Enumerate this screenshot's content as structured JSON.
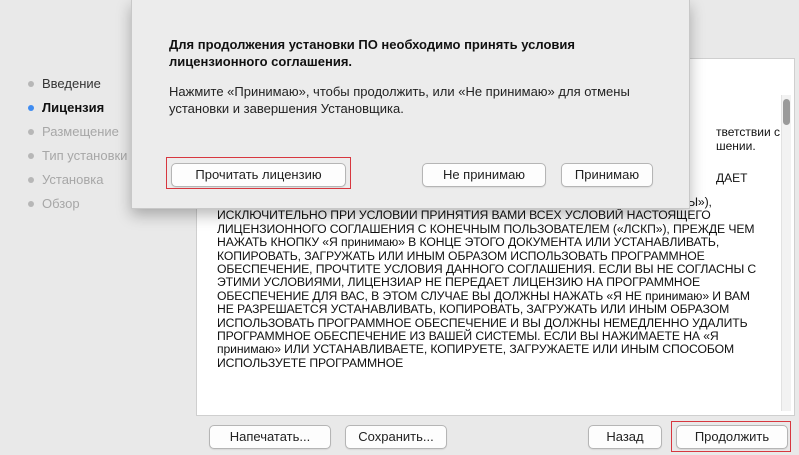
{
  "sidebar": {
    "steps": [
      {
        "label": "Введение",
        "state": "done"
      },
      {
        "label": "Лицензия",
        "state": "active"
      },
      {
        "label": "Размещение",
        "state": "future"
      },
      {
        "label": "Тип установки",
        "state": "future"
      },
      {
        "label": "Установка",
        "state": "future"
      },
      {
        "label": "Обзор",
        "state": "future"
      }
    ]
  },
  "sheet": {
    "title": "Для продолжения установки ПО необходимо принять условия лицензионного соглашения.",
    "body": "Нажмите «Принимаю», чтобы продолжить, или «Не принимаю» для отмены установки и завершения Установщика.",
    "read_license": "Прочитать лицензию",
    "disagree": "Не принимаю",
    "agree": "Принимаю"
  },
  "license": {
    "frag_line1": "тветствии с",
    "frag_line2": "шении.",
    "frag_line3": "ДАЕТ",
    "text": "ЮРИДИЧЕСКОМУ ЛИЦУ, ПРИНИМАЮЩЕМУ ПРОГРАММНОЕ ОБЕСПЕЧЕНИЕ («ВЫ»), ИСКЛЮЧИТЕЛЬНО ПРИ УСЛОВИИ ПРИНЯТИЯ ВАМИ ВСЕХ УСЛОВИЙ НАСТОЯЩЕГО ЛИЦЕНЗИОННОГО СОГЛАШЕНИЯ С КОНЕЧНЫМ ПОЛЬЗОВАТЕЛЕМ («ЛСКП»), ПРЕЖДЕ ЧЕМ НАЖАТЬ КНОПКУ «Я принимаю» В КОНЦЕ ЭТОГО ДОКУМЕНТА ИЛИ УСТАНАВЛИВАТЬ, КОПИРОВАТЬ, ЗАГРУЖАТЬ ИЛИ ИНЫМ ОБРАЗОМ ИСПОЛЬЗОВАТЬ ПРОГРАММНОЕ ОБЕСПЕЧЕНИЕ, ПРОЧТИТЕ УСЛОВИЯ ДАННОГО СОГЛАШЕНИЯ. ЕСЛИ ВЫ НЕ СОГЛАСНЫ С ЭТИМИ УСЛОВИЯМИ, ЛИЦЕНЗИАР НЕ ПЕРЕДАЕТ ЛИЦЕНЗИЮ НА ПРОГРАММНОЕ ОБЕСПЕЧЕНИЕ ДЛЯ ВАС, В ЭТОМ СЛУЧАЕ ВЫ ДОЛЖНЫ НАЖАТЬ «Я НЕ принимаю» И ВАМ НЕ РАЗРЕШАЕТСЯ УСТАНАВЛИВАТЬ, КОПИРОВАТЬ, ЗАГРУЖАТЬ ИЛИ ИНЫМ ОБРАЗОМ ИСПОЛЬЗОВАТЬ ПРОГРАММНОЕ ОБЕСПЕЧЕНИЕ И ВЫ ДОЛЖНЫ НЕМЕДЛЕННО УДАЛИТЬ ПРОГРАММНОЕ ОБЕСПЕЧЕНИЕ ИЗ ВАШЕЙ СИСТЕМЫ. ЕСЛИ ВЫ НАЖИМАЕТЕ НА «Я принимаю» ИЛИ УСТАНАВЛИВАЕТЕ, КОПИРУЕТЕ, ЗАГРУЖАЕТЕ ИЛИ ИНЫМ СПОСОБОМ ИСПОЛЬЗУЕТЕ ПРОГРАММНОЕ"
  },
  "footer": {
    "print": "Напечатать...",
    "save": "Сохранить...",
    "back": "Назад",
    "continue": "Продолжить"
  },
  "colors": {
    "active_dot": "#3f8cf1",
    "highlight": "#d7373f"
  }
}
